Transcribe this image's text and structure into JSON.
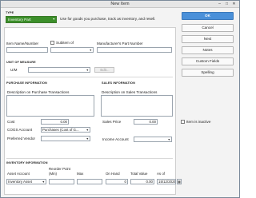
{
  "window": {
    "title": "New Item"
  },
  "type_section": {
    "label": "TYPE",
    "type_value": "Inventory Part",
    "description": "Use for goods you purchase, track as inventory, and resell."
  },
  "buttons": {
    "ok": "OK",
    "cancel": "Cancel",
    "next": "Next",
    "notes": "Notes",
    "custom_fields": "Custom Fields",
    "spelling": "Spelling"
  },
  "item": {
    "name_label": "Item Name/Number",
    "subitem_label": "Subitem of",
    "mpn_label": "Manufacturer's Part Number"
  },
  "unit_of_measure": {
    "section": "UNIT OF MEASURE",
    "um_label": "U/M",
    "edit_label": "Edit..."
  },
  "purchase": {
    "section": "PURCHASE INFORMATION",
    "desc_label": "Description on Purchase Transactions",
    "cost_label": "Cost",
    "cost_value": "0.00",
    "cogs_label": "COGS Account",
    "cogs_value": "Purchases  (Cost of G...",
    "vendor_label": "Preferred Vendor"
  },
  "sales": {
    "section": "SALES INFORMATION",
    "desc_label": "Description on Sales Transactions",
    "price_label": "Sales Price",
    "price_value": "0.00",
    "income_label": "Income Account"
  },
  "inactive_label": "Item is inactive",
  "inventory": {
    "section": "INVENTORY INFORMATION",
    "asset_account_label": "Asset Account",
    "reorder_label_1": "Reorder Point",
    "reorder_label_2": "(Min)",
    "max_label": "Max",
    "on_hand_label": "On Hand",
    "total_value_label": "Total Value",
    "as_of_label": "As of",
    "asset_account_value": "Inventory Asset",
    "on_hand_value": "0",
    "total_value_value": "0.00",
    "as_of_value": "15/12/2025"
  }
}
